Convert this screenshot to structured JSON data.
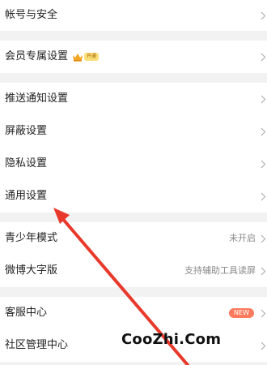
{
  "groups": [
    {
      "items": [
        {
          "label": "帐号与安全"
        }
      ]
    },
    {
      "items": [
        {
          "label": "会员专属设置",
          "vip_badge": "开通",
          "vip_icon": "crown-icon"
        }
      ]
    },
    {
      "items": [
        {
          "label": "推送通知设置"
        },
        {
          "label": "屏蔽设置"
        },
        {
          "label": "隐私设置"
        },
        {
          "label": "通用设置"
        }
      ]
    },
    {
      "items": [
        {
          "label": "青少年模式",
          "value": "未开启"
        },
        {
          "label": "微博大字版",
          "value": "支持辅助工具读屏"
        }
      ]
    },
    {
      "items": [
        {
          "label": "客服中心",
          "badge": "NEW"
        },
        {
          "label": "社区管理中心"
        }
      ]
    }
  ],
  "annotation": {
    "arrow_color": "#e8392b",
    "watermark": "CooZhi.Com"
  },
  "colors": {
    "background": "#f2f2f2",
    "card": "#ffffff",
    "new_badge": "#ff7a5c"
  }
}
